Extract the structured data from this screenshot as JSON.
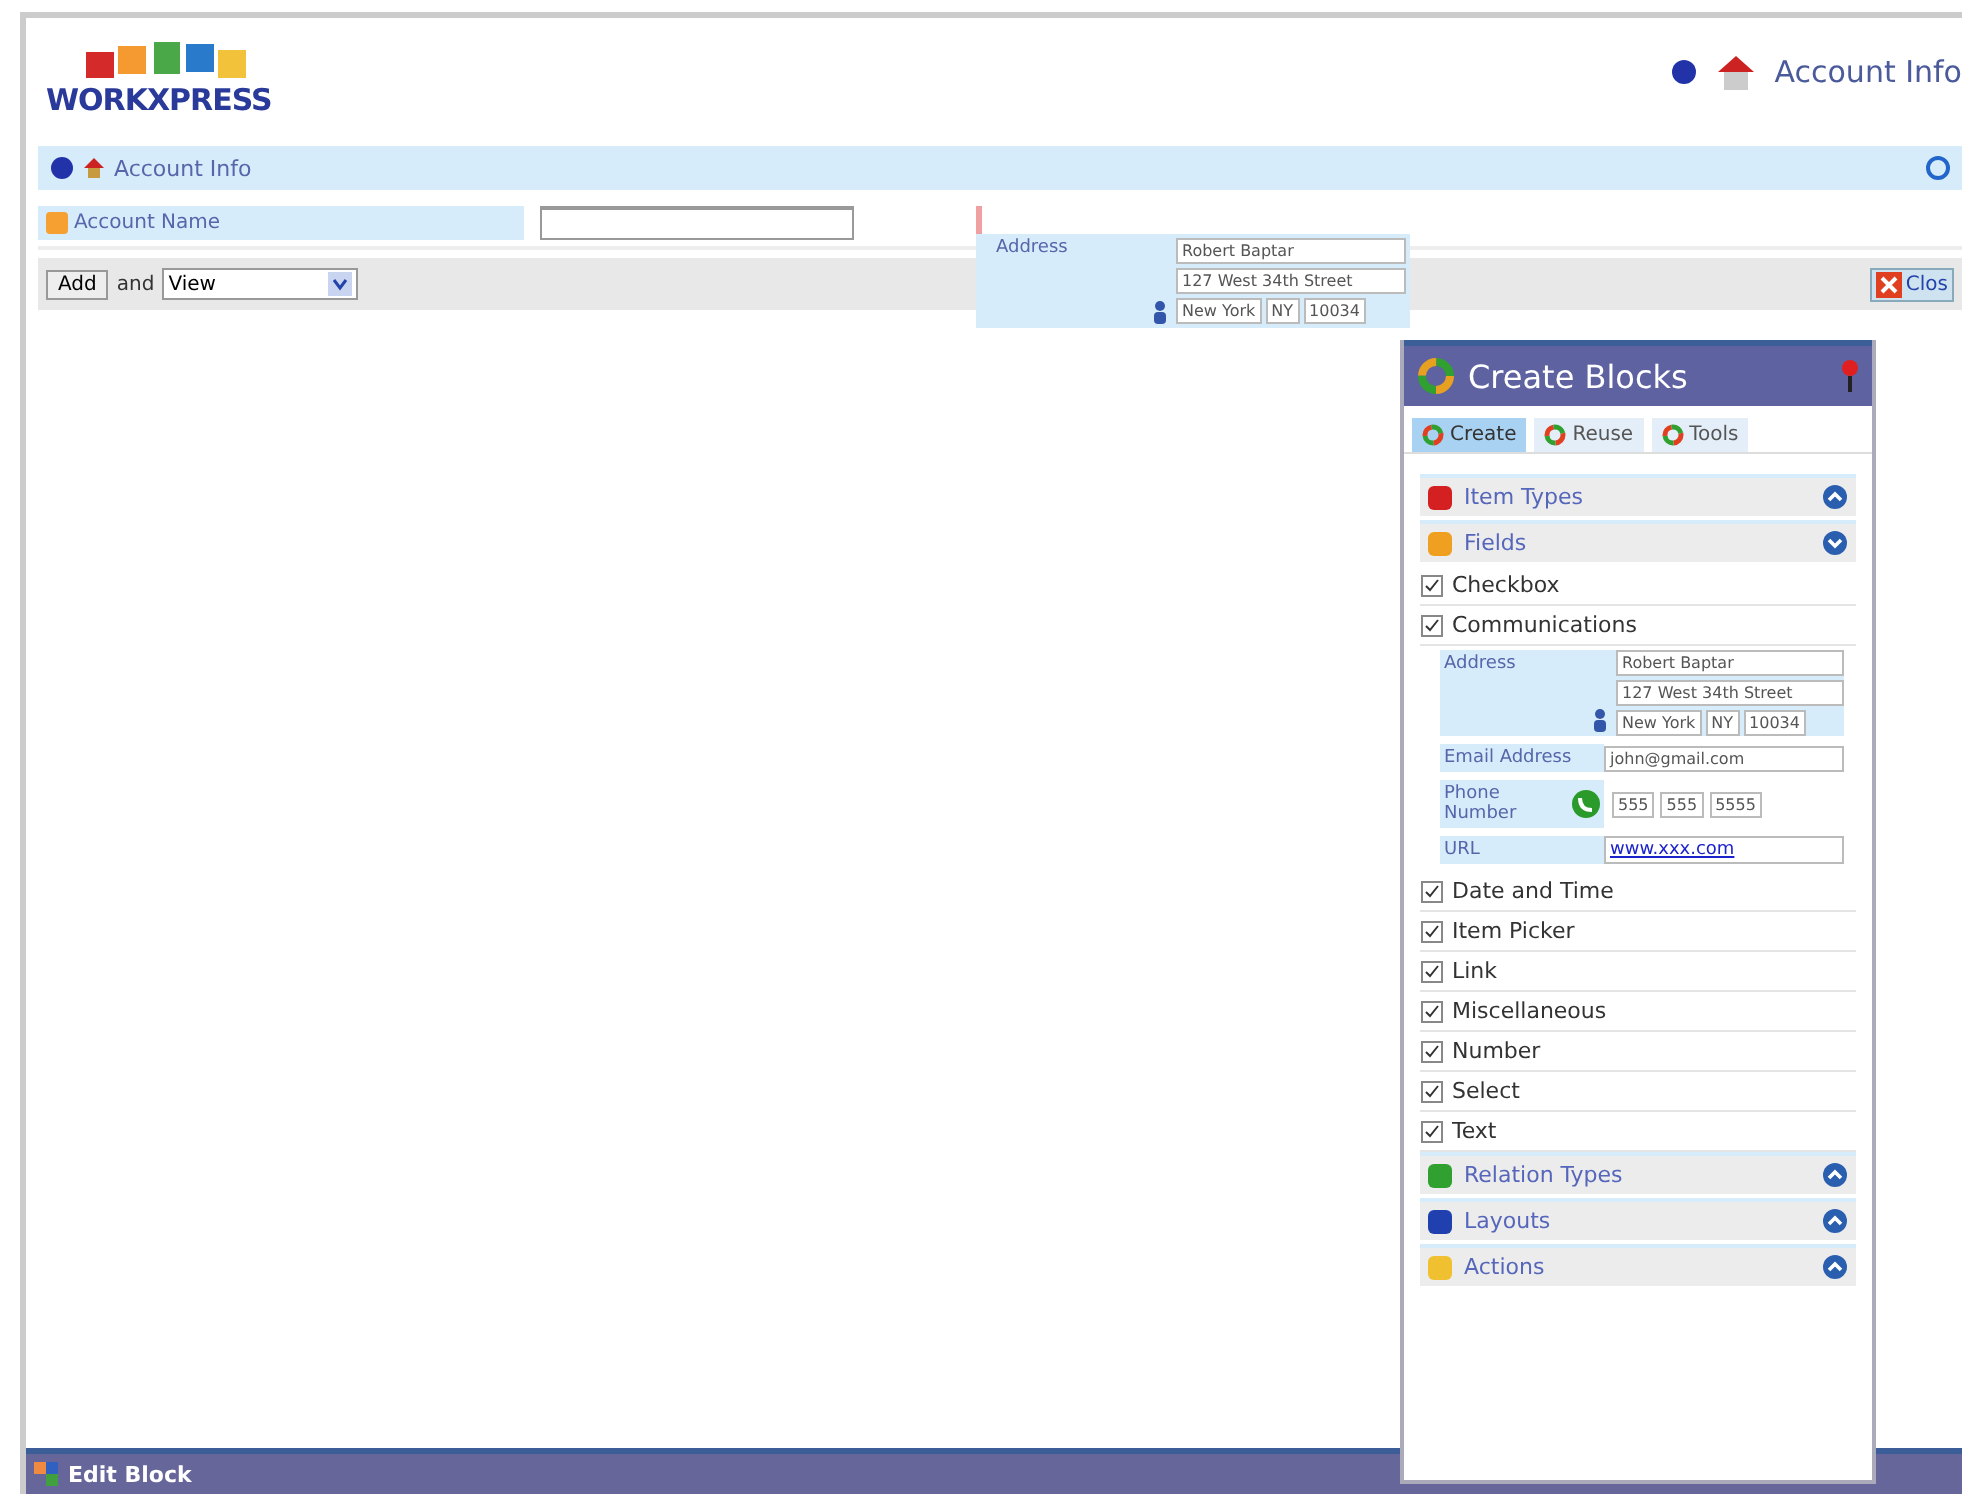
{
  "header": {
    "logo": "WORKXPRESS",
    "account_link": "Account Info"
  },
  "account_bar": {
    "title": "Account Info"
  },
  "account_name": {
    "label": "Account Name"
  },
  "toolbar": {
    "add_button": "Add",
    "and_text": "and",
    "view_select": "View",
    "close_button": "Clos"
  },
  "drag_block": {
    "label": "Address",
    "name": "Robert Baptar",
    "street": "127 West 34th Street",
    "city": "New York",
    "state": "NY",
    "zip": "10034"
  },
  "panel": {
    "title": "Create Blocks",
    "tabs": [
      {
        "label": "Create",
        "selected": true
      },
      {
        "label": "Reuse",
        "selected": false
      },
      {
        "label": "Tools",
        "selected": false
      }
    ],
    "sections": [
      {
        "label": "Item Types",
        "color": "#d42020",
        "expanded": false
      },
      {
        "label": "Fields",
        "color": "#f0a020",
        "expanded": true,
        "items": [
          {
            "label": "Checkbox",
            "kind": "plain"
          },
          {
            "label": "Communications",
            "kind": "communications",
            "preview": {
              "address_label": "Address",
              "name": "Robert Baptar",
              "street": "127 West 34th Street",
              "city": "New York",
              "state": "NY",
              "zip": "10034",
              "email_label": "Email Address",
              "email": "john@gmail.com",
              "phone_label": "Phone Number",
              "phone": [
                "555",
                "555",
                "5555"
              ],
              "url_label": "URL",
              "url": "www.xxx.com"
            }
          },
          {
            "label": "Date and Time",
            "kind": "plain"
          },
          {
            "label": "Item Picker",
            "kind": "plain"
          },
          {
            "label": "Link",
            "kind": "plain"
          },
          {
            "label": "Miscellaneous",
            "kind": "plain"
          },
          {
            "label": "Number",
            "kind": "plain"
          },
          {
            "label": "Select",
            "kind": "plain"
          },
          {
            "label": "Text",
            "kind": "plain"
          }
        ]
      },
      {
        "label": "Relation Types",
        "color": "#30a030",
        "expanded": false
      },
      {
        "label": "Layouts",
        "color": "#2040b0",
        "expanded": false
      },
      {
        "label": "Actions",
        "color": "#f0c030",
        "expanded": false
      }
    ]
  },
  "footer": {
    "title": "Edit Block"
  }
}
